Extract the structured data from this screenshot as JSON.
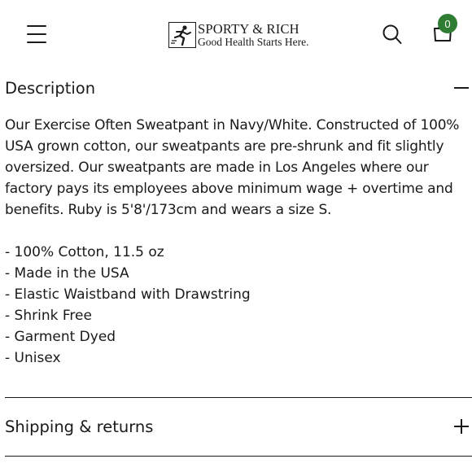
{
  "header": {
    "brand": "SPORTY & RICH",
    "tagline": "Good Health Starts Here.",
    "cart_count": "0",
    "icons": {
      "menu": "hamburger-menu-icon",
      "search": "search-icon",
      "cart": "shopping-bag-icon",
      "logo": "runner-logo-icon"
    },
    "accent_color": "#2e7d32"
  },
  "description": {
    "title": "Description",
    "expanded": true,
    "paragraph": "Our Exercise Often Sweatpant in Navy/White. Constructed of 100% USA grown cotton, our sweatpants are pre-shrunk and fit slightly oversized. Our sweatpants are made in Los Angeles where our factory pays its employees above minimum wage + overtime and benefits. Ruby is 5'8'/173cm and wears a size S.",
    "features": [
      "- 100% Cotton, 11.5 oz",
      "- Made in the USA",
      "- Elastic Waistband with Drawstring",
      "- Shrink Free",
      "- Garment Dyed",
      "- Unisex"
    ]
  },
  "shipping": {
    "title": "Shipping & returns",
    "expanded": false
  }
}
